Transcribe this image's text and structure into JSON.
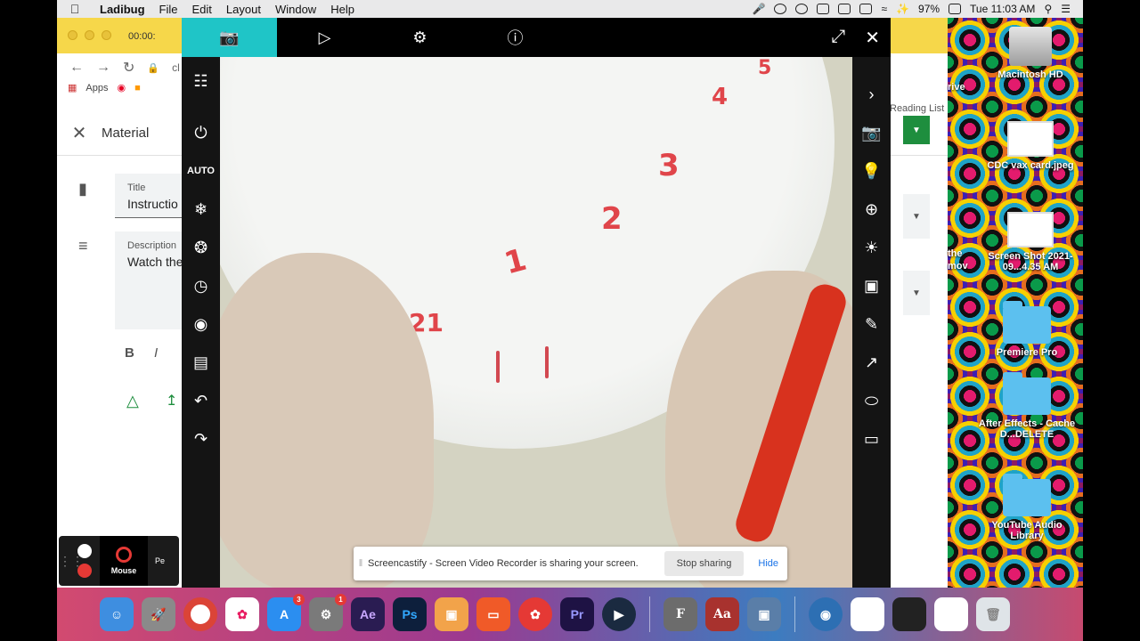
{
  "menubar": {
    "apple_icon": "apple-icon",
    "app_name": "Ladibug",
    "menus": [
      "File",
      "Edit",
      "Layout",
      "Window",
      "Help"
    ],
    "battery": "97%",
    "clock": "Tue 11:03 AM"
  },
  "browser": {
    "timer": "00:00:",
    "url_fragment": "cl",
    "bookmarks": [
      "Apps"
    ],
    "reading_list": "Reading List",
    "material_header": "Material",
    "title_caption": "Title",
    "title_value": "Instructio",
    "description_caption": "Description",
    "description_value": "Watch the",
    "format_bold": "B",
    "format_italic": "I"
  },
  "ladibug": {
    "tabs": [
      {
        "name": "camera",
        "icon": "camera-icon"
      },
      {
        "name": "playback",
        "icon": "play-icon"
      },
      {
        "name": "settings",
        "icon": "gear-icon"
      },
      {
        "name": "info",
        "icon": "info-icon"
      }
    ],
    "auto_label": "AUTO",
    "plate_numbers": [
      "1",
      "2",
      "3",
      "4",
      "5",
      "2",
      "21"
    ]
  },
  "share_banner": {
    "message": "Screencastify - Screen Video Recorder is sharing your screen.",
    "stop_label": "Stop sharing",
    "hide_label": "Hide"
  },
  "screencastify": {
    "mouse_label": "Mouse",
    "pen_label": "Pe"
  },
  "desktop": {
    "icons": [
      {
        "label": "Macintosh HD"
      },
      {
        "label": "CDC vax card.jpeg"
      },
      {
        "label": "Screen Shot 2021-09...4.35 AM"
      },
      {
        "label": "Premiere Pro"
      },
      {
        "label": "After Effects - Cache D...DELETE"
      },
      {
        "label": "YouTube Audio Library"
      }
    ],
    "partial_left_texts": [
      "rive",
      "the",
      "mov"
    ]
  },
  "dock": {
    "apps": [
      {
        "name": "Finder",
        "color": "#3e8ee0"
      },
      {
        "name": "Launchpad",
        "color": "#8a8a8a"
      },
      {
        "name": "Chrome",
        "color": "#ffffff"
      },
      {
        "name": "Photos",
        "color": "#ffffff"
      },
      {
        "name": "App Store",
        "color": "#2b8ef0",
        "badge": "3"
      },
      {
        "name": "System Preferences",
        "color": "#7a7a7a",
        "badge": "1"
      },
      {
        "name": "After Effects",
        "label": "Ae",
        "color": "#2a1c52"
      },
      {
        "name": "Photoshop",
        "label": "Ps",
        "color": "#0d1f3c"
      },
      {
        "name": "Preview",
        "color": "#f2a34a"
      },
      {
        "name": "Screencastify",
        "color": "#f05a28"
      },
      {
        "name": "Ladibug",
        "color": "#e53935"
      },
      {
        "name": "Premiere Pro",
        "label": "Pr",
        "color": "#1e1244"
      },
      {
        "name": "QuickTime",
        "color": "#1a2a40"
      },
      {
        "name": "Font Book",
        "label": "F",
        "color": "#6c6c6c"
      },
      {
        "name": "Dictionary",
        "label": "Aa",
        "color": "#a8322e"
      },
      {
        "name": "Image Capture",
        "color": "#5a7ea8"
      },
      {
        "name": "Network",
        "color": "#2d6fb3"
      },
      {
        "name": "Doc1",
        "color": "#ffffff"
      },
      {
        "name": "Doc2",
        "color": "#222222"
      },
      {
        "name": "Doc3",
        "color": "#ffffff"
      },
      {
        "name": "Trash",
        "color": "#dfe4e8"
      }
    ]
  }
}
